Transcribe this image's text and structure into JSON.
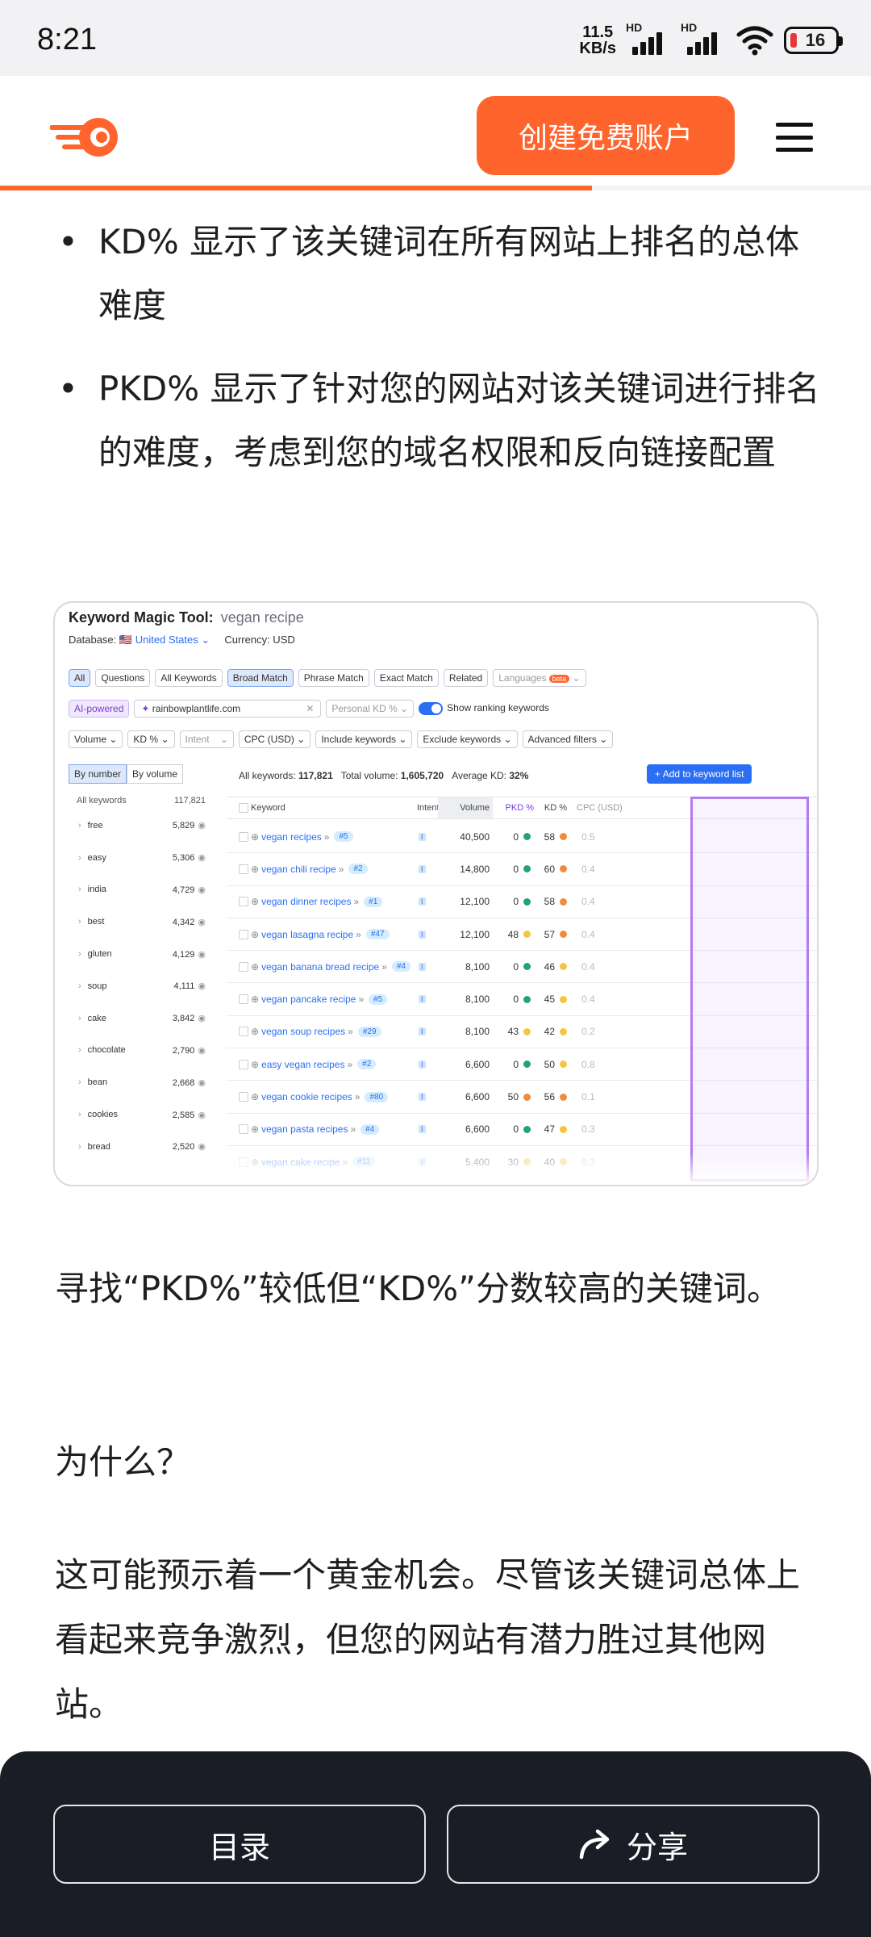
{
  "status_bar": {
    "time": "8:21",
    "net_speed_value": "11.5",
    "net_speed_unit": "KB/s",
    "signal_label": "HD",
    "battery": "16",
    "battery_level_percent": 16
  },
  "header": {
    "cta_label": "创建免费账户",
    "reading_progress_percent": 68,
    "brand_color": "#ff642d"
  },
  "article": {
    "bullets": [
      {
        "text": "KD% 显示了该关键词在所有网站上排名的总体难度"
      },
      {
        "text": "PKD% 显示了针对您的网站对该关键词进行排名的难度，考虑到您的域名权限和反向链接配置"
      }
    ],
    "paragraph_1": "寻找“PKD%”较低但“KD%”分数较高的关键词。",
    "paragraph_2": "为什么？",
    "paragraph_3": "这可能预示着一个黄金机会。尽管该关键词总体上看起来竞争激烈，但您的网站有潜力胜过其他网站。"
  },
  "screenshot": {
    "title_bold": "Keyword Magic Tool:",
    "title_query": "vegan recipe",
    "database_label": "Database:",
    "database_value": "United States",
    "currency": "Currency: USD",
    "match_tabs": [
      "All",
      "Questions",
      "All Keywords",
      "Broad Match",
      "Phrase Match",
      "Exact Match",
      "Related"
    ],
    "languages_label": "Languages",
    "beta_label": "beta",
    "ai_label": "AI-powered",
    "domain": "rainbowplantlife.com",
    "personal_kd_label": "Personal KD %",
    "show_ranking_label": "Show ranking keywords",
    "filters": [
      "Volume",
      "KD %",
      "Intent",
      "CPC (USD)",
      "Include keywords",
      "Exclude keywords",
      "Advanced filters"
    ],
    "group_tabs": [
      "By number",
      "By volume"
    ],
    "groups_header": "All keywords",
    "groups_header_count": "117,821",
    "groups": [
      {
        "name": "free",
        "count": "5,829"
      },
      {
        "name": "easy",
        "count": "5,306"
      },
      {
        "name": "india",
        "count": "4,729"
      },
      {
        "name": "best",
        "count": "4,342"
      },
      {
        "name": "gluten",
        "count": "4,129"
      },
      {
        "name": "soup",
        "count": "4,111"
      },
      {
        "name": "cake",
        "count": "3,842"
      },
      {
        "name": "chocolate",
        "count": "2,790"
      },
      {
        "name": "bean",
        "count": "2,668"
      },
      {
        "name": "cookies",
        "count": "2,585"
      },
      {
        "name": "bread",
        "count": "2,520"
      }
    ],
    "summary_all_label": "All keywords:",
    "summary_all_value": "117,821",
    "summary_volume_label": "Total volume:",
    "summary_volume_value": "1,605,720",
    "summary_kd_label": "Average KD:",
    "summary_kd_value": "32%",
    "add_button": "Add to keyword list",
    "columns": {
      "keyword": "Keyword",
      "intent": "Intent",
      "volume": "Volume",
      "pkd": "PKD %",
      "kd": "KD %",
      "cpc": "CPC (USD)"
    },
    "rows": [
      {
        "keyword": "vegan recipes",
        "pos": "#5",
        "intent": "I",
        "volume": "40,500",
        "pkd": "0",
        "pkd_color": "#1fa37a",
        "kd": "58",
        "kd_color": "#f08a3c",
        "cpc": "0.5"
      },
      {
        "keyword": "vegan chili recipe",
        "pos": "#2",
        "intent": "I",
        "volume": "14,800",
        "pkd": "0",
        "pkd_color": "#1fa37a",
        "kd": "60",
        "kd_color": "#f08a3c",
        "cpc": "0.4"
      },
      {
        "keyword": "vegan dinner recipes",
        "pos": "#1",
        "intent": "I",
        "volume": "12,100",
        "pkd": "0",
        "pkd_color": "#1fa37a",
        "kd": "58",
        "kd_color": "#f08a3c",
        "cpc": "0.4"
      },
      {
        "keyword": "vegan lasagna recipe",
        "pos": "#47",
        "intent": "I",
        "volume": "12,100",
        "pkd": "48",
        "pkd_color": "#f5c542",
        "kd": "57",
        "kd_color": "#f08a3c",
        "cpc": "0.4"
      },
      {
        "keyword": "vegan banana bread recipe",
        "pos": "#4",
        "intent": "I",
        "volume": "8,100",
        "pkd": "0",
        "pkd_color": "#1fa37a",
        "kd": "46",
        "kd_color": "#f5c542",
        "cpc": "0.4"
      },
      {
        "keyword": "vegan pancake recipe",
        "pos": "#5",
        "intent": "I",
        "volume": "8,100",
        "pkd": "0",
        "pkd_color": "#1fa37a",
        "kd": "45",
        "kd_color": "#f5c542",
        "cpc": "0.4"
      },
      {
        "keyword": "vegan soup recipes",
        "pos": "#29",
        "intent": "I",
        "volume": "8,100",
        "pkd": "43",
        "pkd_color": "#f5c542",
        "kd": "42",
        "kd_color": "#f5c542",
        "cpc": "0.2"
      },
      {
        "keyword": "easy vegan recipes",
        "pos": "#2",
        "intent": "I",
        "volume": "6,600",
        "pkd": "0",
        "pkd_color": "#1fa37a",
        "kd": "50",
        "kd_color": "#f5c542",
        "cpc": "0.8"
      },
      {
        "keyword": "vegan cookie recipes",
        "pos": "#80",
        "intent": "I",
        "volume": "6,600",
        "pkd": "50",
        "pkd_color": "#f08a3c",
        "kd": "56",
        "kd_color": "#f08a3c",
        "cpc": "0.1"
      },
      {
        "keyword": "vegan pasta recipes",
        "pos": "#4",
        "intent": "I",
        "volume": "6,600",
        "pkd": "0",
        "pkd_color": "#1fa37a",
        "kd": "47",
        "kd_color": "#f5c542",
        "cpc": "0.3"
      },
      {
        "keyword": "vegan cake recipe",
        "pos": "#11",
        "intent": "I",
        "volume": "5,400",
        "pkd": "30",
        "pkd_color": "#f5c542",
        "kd": "40",
        "kd_color": "#f5c542",
        "cpc": "0.3"
      }
    ]
  },
  "bottom_bar": {
    "toc_label": "目录",
    "share_label": "分享"
  }
}
